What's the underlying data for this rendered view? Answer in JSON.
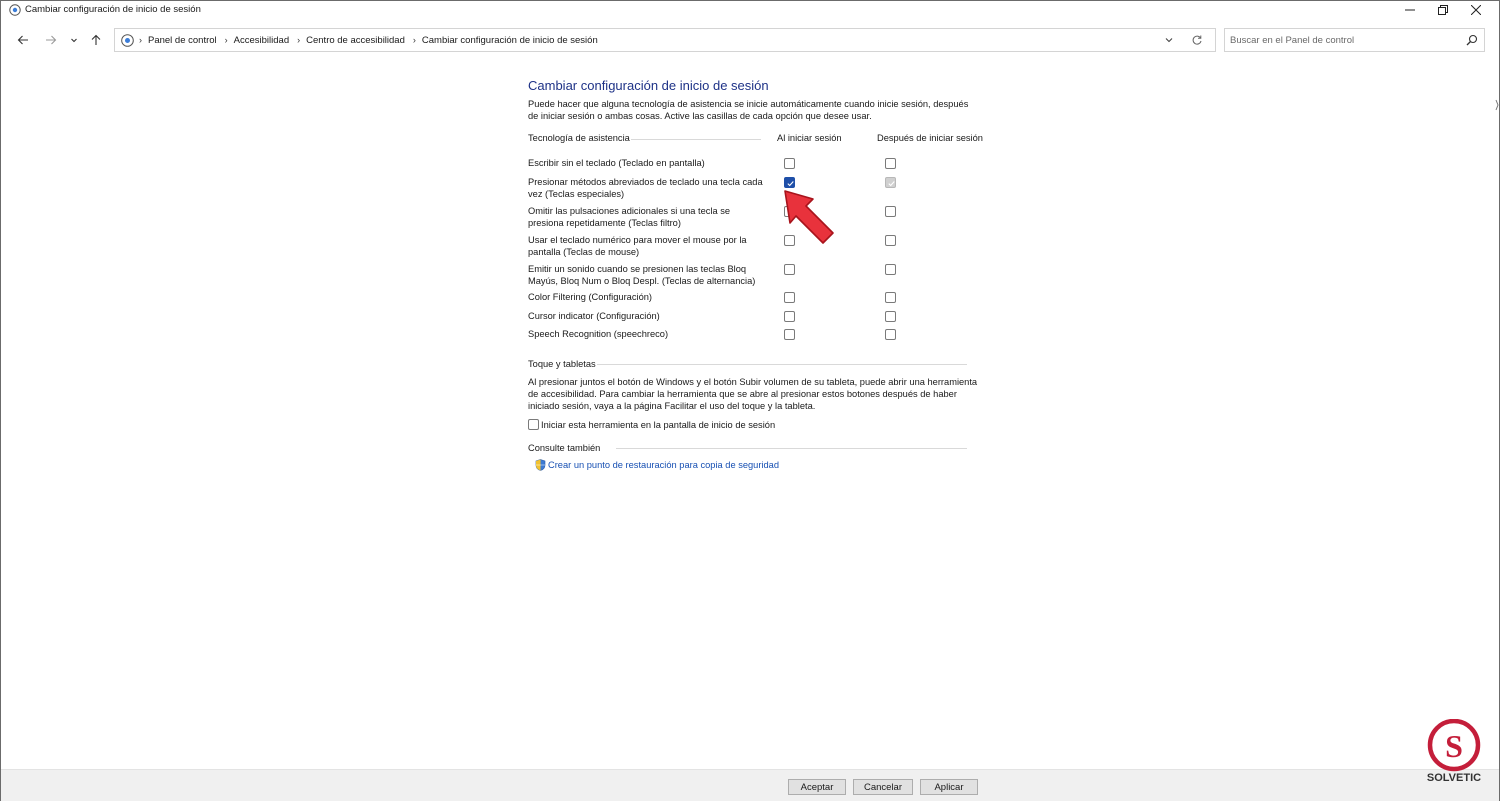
{
  "window": {
    "title": "Cambiar configuración de inicio de sesión",
    "icon": "control-panel-icon"
  },
  "nav": {
    "back": "back-arrow-icon",
    "forward": "forward-arrow-icon",
    "recent": "chevron-down-icon",
    "up": "up-arrow-icon"
  },
  "breadcrumbs": [
    "Panel de control",
    "Accesibilidad",
    "Centro de accesibilidad",
    "Cambiar configuración de inicio de sesión"
  ],
  "search": {
    "placeholder": "Buscar en el Panel de control"
  },
  "page": {
    "title": "Cambiar configuración de inicio de sesión",
    "intro": "Puede hacer que alguna tecnología de asistencia se inicie automáticamente cuando inicie sesión, después de iniciar sesión o ambas cosas. Active las casillas de cada opción que desee usar.",
    "columns": {
      "tech": "Tecnología de asistencia",
      "at_signin": "Al iniciar sesión",
      "after_signin": "Después de iniciar sesión"
    },
    "rows": [
      {
        "label": "Escribir sin el teclado (Teclado en pantalla)",
        "at_signin": false,
        "after_signin": false
      },
      {
        "label": "Presionar métodos abreviados de teclado una tecla cada vez (Teclas especiales)",
        "at_signin": true,
        "after_signin": true
      },
      {
        "label": "Omitir las pulsaciones adicionales si una tecla se presiona repetidamente (Teclas filtro)",
        "at_signin": false,
        "after_signin": false
      },
      {
        "label": "Usar el teclado numérico para mover el mouse por la pantalla (Teclas de mouse)",
        "at_signin": false,
        "after_signin": false
      },
      {
        "label": "Emitir un sonido cuando se presionen las teclas Bloq Mayús, Bloq Num o Bloq Despl. (Teclas de alternancia)",
        "at_signin": false,
        "after_signin": false
      },
      {
        "label": "Color Filtering (Configuración)",
        "at_signin": false,
        "after_signin": false
      },
      {
        "label": "Cursor indicator (Configuración)",
        "at_signin": false,
        "after_signin": false
      },
      {
        "label": "Speech Recognition (speechreco)",
        "at_signin": false,
        "after_signin": false
      }
    ],
    "touch": {
      "heading": "Toque y tabletas",
      "text": "Al presionar juntos el botón de Windows y el botón Subir volumen de su tableta, puede abrir una herramienta de accesibilidad. Para cambiar la herramienta que se abre al presionar estos botones después de haber iniciado sesión, vaya a la página Facilitar el uso del toque y la tableta.",
      "checkbox_label": "Iniciar esta herramienta en la pantalla de inicio de sesión",
      "checked": false
    },
    "see_also": {
      "heading": "Consulte también",
      "link": "Crear un punto de restauración para copia de seguridad",
      "link_icon": "shield-icon"
    }
  },
  "buttons": {
    "ok": "Aceptar",
    "cancel": "Cancelar",
    "apply": "Aplicar"
  },
  "colors": {
    "title_blue": "#1e3287",
    "link_blue": "#1750b3",
    "checkbox_checked": "#1f4fa8",
    "arrow_red": "#e8323c"
  }
}
